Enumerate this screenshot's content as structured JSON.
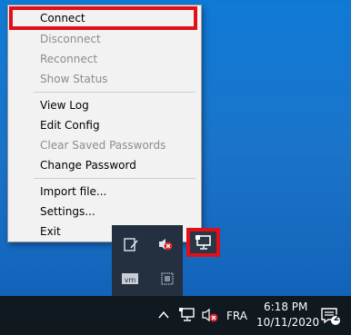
{
  "menu": {
    "items": [
      {
        "label": "Connect",
        "enabled": true
      },
      {
        "label": "Disconnect",
        "enabled": false
      },
      {
        "label": "Reconnect",
        "enabled": false
      },
      {
        "label": "Show Status",
        "enabled": false
      },
      {
        "label": "View Log",
        "enabled": true
      },
      {
        "label": "Edit Config",
        "enabled": true
      },
      {
        "label": "Clear Saved Passwords",
        "enabled": false
      },
      {
        "label": "Change Password",
        "enabled": true
      },
      {
        "label": "Import file...",
        "enabled": true
      },
      {
        "label": "Settings...",
        "enabled": true
      },
      {
        "label": "Exit",
        "enabled": true
      }
    ]
  },
  "taskbar": {
    "language": "FRA",
    "time": "6:18 PM",
    "date": "10/11/2020",
    "notification_count": "2"
  },
  "colors": {
    "highlight": "#e0101a",
    "desktop": "#1b74c9",
    "taskbar": "#101820"
  }
}
